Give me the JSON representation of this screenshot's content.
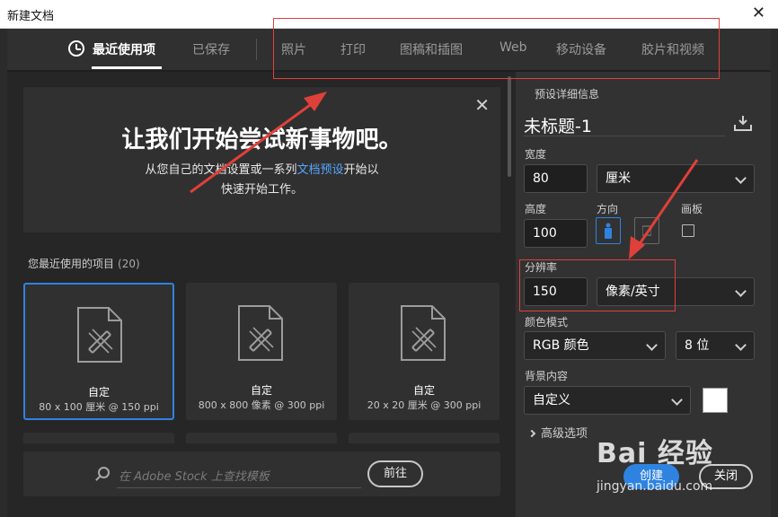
{
  "window": {
    "title": "新建文档"
  },
  "tabs": [
    {
      "label": "最近使用项",
      "active": true
    },
    {
      "label": "已保存"
    },
    {
      "label": "照片"
    },
    {
      "label": "打印"
    },
    {
      "label": "图稿和插图"
    },
    {
      "label": "Web"
    },
    {
      "label": "移动设备"
    },
    {
      "label": "胶片和视频"
    }
  ],
  "welcome": {
    "headline": "让我们开始尝试新事物吧。",
    "line1_before": "从您自己的文档设置或一系列",
    "line1_link": "文档预设",
    "line1_after": "开始以",
    "line2": "快速开始工作。"
  },
  "recent": {
    "title": "您最近使用的项目",
    "count": "(20)",
    "items": [
      {
        "name": "自定",
        "size": "80 x 100 厘米 @ 150 ppi"
      },
      {
        "name": "自定",
        "size": "800 x 800 像素 @ 300 ppi"
      },
      {
        "name": "自定",
        "size": "20 x 20 厘米 @ 300 ppi"
      }
    ]
  },
  "stock": {
    "placeholder": "在 Adobe Stock 上查找模板",
    "go_label": "前往"
  },
  "preset": {
    "section_title": "预设详细信息",
    "doc_name": "未标题-1",
    "width_label": "宽度",
    "width_value": "80",
    "width_unit": "厘米",
    "height_label": "高度",
    "height_value": "100",
    "orientation_label": "方向",
    "artboard_label": "画板",
    "resolution_label": "分辨率",
    "resolution_value": "150",
    "resolution_unit": "像素/英寸",
    "color_mode_label": "颜色模式",
    "color_mode_value": "RGB 颜色",
    "bit_depth": "8 位",
    "background_label": "背景内容",
    "background_value": "自定义",
    "advanced_label": "高级选项",
    "create_label": "创建",
    "close_label": "关闭"
  },
  "watermark": {
    "logo_text": "Bai 经验",
    "url": "jingyan.baidu.com"
  },
  "colors": {
    "accent": "#2f83e0",
    "annotation": "#e0403a",
    "panel": "#323232"
  }
}
